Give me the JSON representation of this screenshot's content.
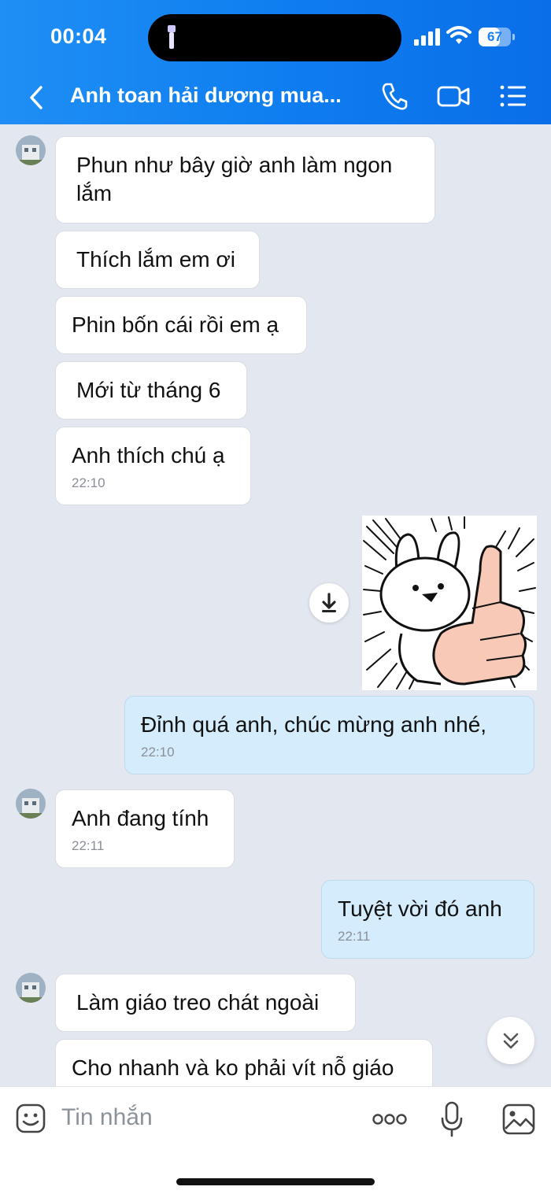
{
  "status": {
    "time": "00:04",
    "battery": "67",
    "battery_level": 0.67
  },
  "header": {
    "title": "Anh toan hải dương mua..."
  },
  "messages": [
    {
      "text": "Phun như bây giờ anh làm ngon lắm"
    },
    {
      "text": "Thích lắm em ơi"
    },
    {
      "text": "Phin bốn cái rồi em ạ"
    },
    {
      "text": "Mới từ tháng 6"
    },
    {
      "text": "Anh thích chú ạ",
      "time": "22:10"
    },
    {
      "text": "Đỉnh quá anh, chúc mừng anh nhé,",
      "time": "22:10"
    },
    {
      "text": "Anh đang tính",
      "time": "22:11"
    },
    {
      "text": "Tuyệt vời đó anh",
      "time": "22:11"
    },
    {
      "text": "Làm giáo treo chát ngoài"
    },
    {
      "text": "Cho nhanh và ko phải vít nỗ giáo"
    }
  ],
  "composer": {
    "placeholder": "Tin nhắn"
  },
  "colors": {
    "header": "#1a86f2",
    "chat_bg": "#e2e7f0",
    "my_bubble": "#d5ecfc",
    "their_bubble": "#ffffff"
  },
  "icons": [
    "flashlight-icon",
    "cellular-signal-icon",
    "wifi-icon",
    "battery-icon",
    "back-chevron-icon",
    "phone-icon",
    "video-call-icon",
    "menu-list-icon",
    "download-icon",
    "double-chevron-down-icon",
    "emoji-icon",
    "more-icon",
    "microphone-icon",
    "image-icon"
  ]
}
